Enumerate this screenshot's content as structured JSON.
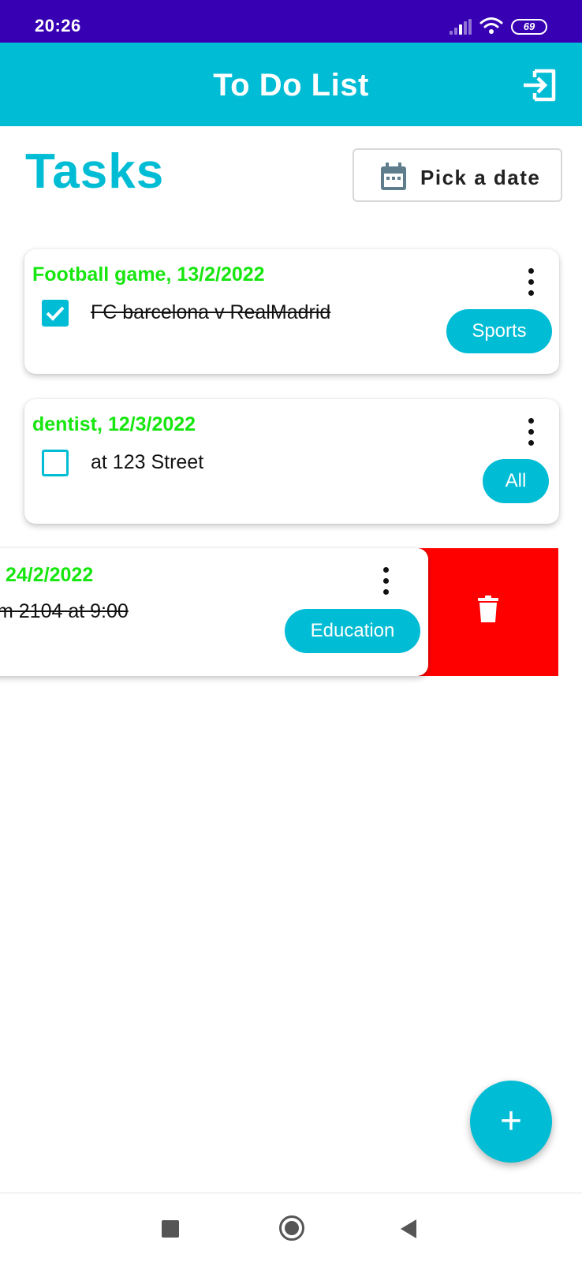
{
  "status_bar": {
    "time": "20:26",
    "battery": "69"
  },
  "app_bar": {
    "title": "To Do List",
    "logout_icon": "logout-icon"
  },
  "header": {
    "title": "Tasks",
    "pick_date_label": "Pick a date",
    "calendar_icon": "calendar-icon"
  },
  "tasks": [
    {
      "title": "Football game, 13/2/2022",
      "description": "FC  barcelona v RealMadrid",
      "completed": true,
      "category": "Sports"
    },
    {
      "title": "dentist, 12/3/2022",
      "description": "at 123 Street",
      "completed": false,
      "category": "All"
    },
    {
      "title": "24/2/2022",
      "description": "m 2104 at 9:00",
      "completed": true,
      "category": "Education",
      "swiped_for_delete": true
    }
  ],
  "fab_label": "+",
  "colors": {
    "primary": "#00bcd4",
    "status_bar": "#3700b3",
    "title_green": "#17e60f",
    "delete_red": "#ff0000"
  }
}
